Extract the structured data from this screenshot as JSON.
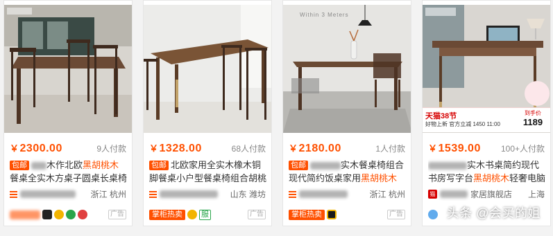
{
  "products": [
    {
      "price_symbol": "￥",
      "price": "2300.00",
      "sales": "9人付款",
      "baoyou": "包邮",
      "title_pre": "木作北欧",
      "title_hl": "黑胡桃木",
      "title_post": "餐桌全实木方桌子圆桌长桌椅",
      "shop": "",
      "location": "浙江 杭州",
      "badge": "",
      "ad": "广告"
    },
    {
      "price_symbol": "￥",
      "price": "1328.00",
      "sales": "68人付款",
      "baoyou": "包邮",
      "title_pre": "北欧家用全实木橡木铜脚餐桌小户型餐桌椅组合胡桃",
      "title_hl": "",
      "title_post": "",
      "shop": "",
      "location": "山东 潍坊",
      "badge": "掌柜热卖",
      "fu": "服",
      "ad": "广告"
    },
    {
      "price_symbol": "￥",
      "price": "2180.00",
      "sales": "1人付款",
      "baoyou": "包邮",
      "title_pre": "实木餐桌椅组合现代简约饭桌家用",
      "title_hl": "黑胡桃木",
      "title_post": "",
      "shop": "",
      "location": "浙江 杭州",
      "badge": "掌柜热卖",
      "ad": "广告",
      "brand_text": "Within 3 Meters"
    },
    {
      "price_symbol": "￥",
      "price": "1539.00",
      "sales": "100+人付款",
      "baoyou": "",
      "title_pre": "实木书桌简约现代书房写字台",
      "title_hl": "黑胡桃木",
      "title_post": "轻奢电脑桌",
      "shop": "家居旗舰店",
      "location": "上海",
      "badge": "",
      "ad": "广告",
      "promo": {
        "tmall": "天猫38节",
        "line": "好物上新 官方立减  1450  11:00",
        "label": "到手价",
        "num": "1189"
      }
    }
  ],
  "watermark": "头条 @会买的姐",
  "colors": {
    "accent": "#ff5000",
    "tmall": "#d60000"
  }
}
